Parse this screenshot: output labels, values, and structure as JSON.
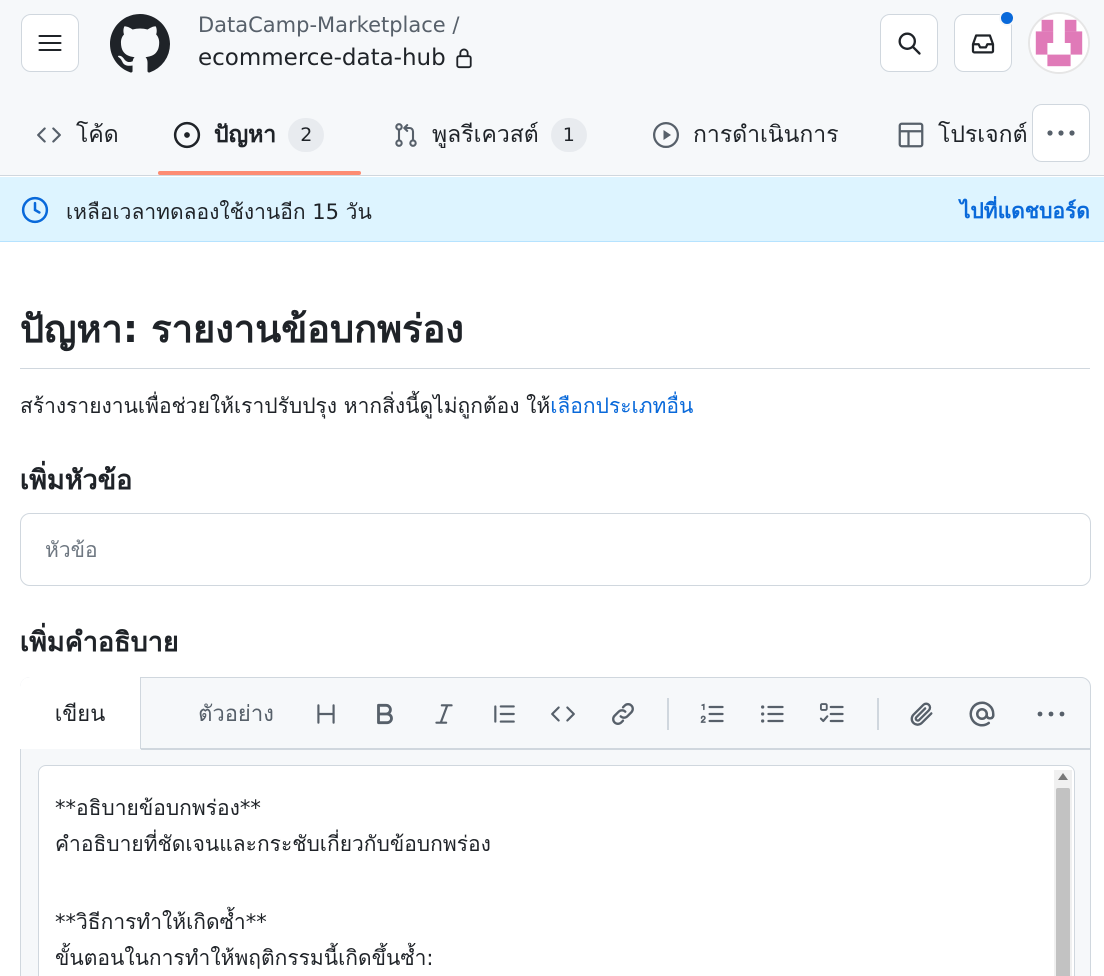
{
  "header": {
    "owner": "DataCamp-Marketplace /",
    "repo": "ecommerce-data-hub",
    "notification_color": "#0969da"
  },
  "tabs": [
    {
      "label": "โค้ด",
      "icon": "code-icon"
    },
    {
      "label": "ปัญหา",
      "icon": "issue-opened-icon",
      "count": "2",
      "selected": true
    },
    {
      "label": "พูลรีเควสต์",
      "icon": "git-pull-request-icon",
      "count": "1"
    },
    {
      "label": "การดำเนินการ",
      "icon": "play-icon"
    },
    {
      "label": "โปรเจกต์",
      "icon": "table-icon"
    }
  ],
  "banner": {
    "text": "เหลือเวลาทดลองใช้งานอีก 15 วัน",
    "link": "ไปที่แดชบอร์ด"
  },
  "page": {
    "title": "ปัญหา: รายงานข้อบกพร่อง",
    "intro": "สร้างรายงานเพื่อช่วยให้เราปรับปรุง หากสิ่งนี้ดูไม่ถูกต้อง ให้",
    "intro_link": "เลือกประเภทอื่น"
  },
  "form": {
    "title_label": "เพิ่มหัวข้อ",
    "title_placeholder": "หัวข้อ",
    "desc_label": "เพิ่มคำอธิบาย"
  },
  "editor": {
    "tab_write": "เขียน",
    "tab_preview": "ตัวอย่าง",
    "toolbar": [
      "heading-icon",
      "bold-icon",
      "italic-icon",
      "quote-icon",
      "code-icon",
      "link-icon",
      "numbered-list-icon",
      "bulleted-list-icon",
      "task-list-icon",
      "attach-icon",
      "mention-icon",
      "more-icon"
    ],
    "lines": [
      "**อธิบายข้อบกพร่อง**",
      "คำอธิบายที่ชัดเจนและกระชับเกี่ยวกับข้อบกพร่อง",
      "",
      "**วิธีการทำให้เกิดซ้ำ**",
      "ขั้นตอนในการทำให้พฤติกรรมนี้เกิดขึ้นซ้ำ:"
    ]
  }
}
